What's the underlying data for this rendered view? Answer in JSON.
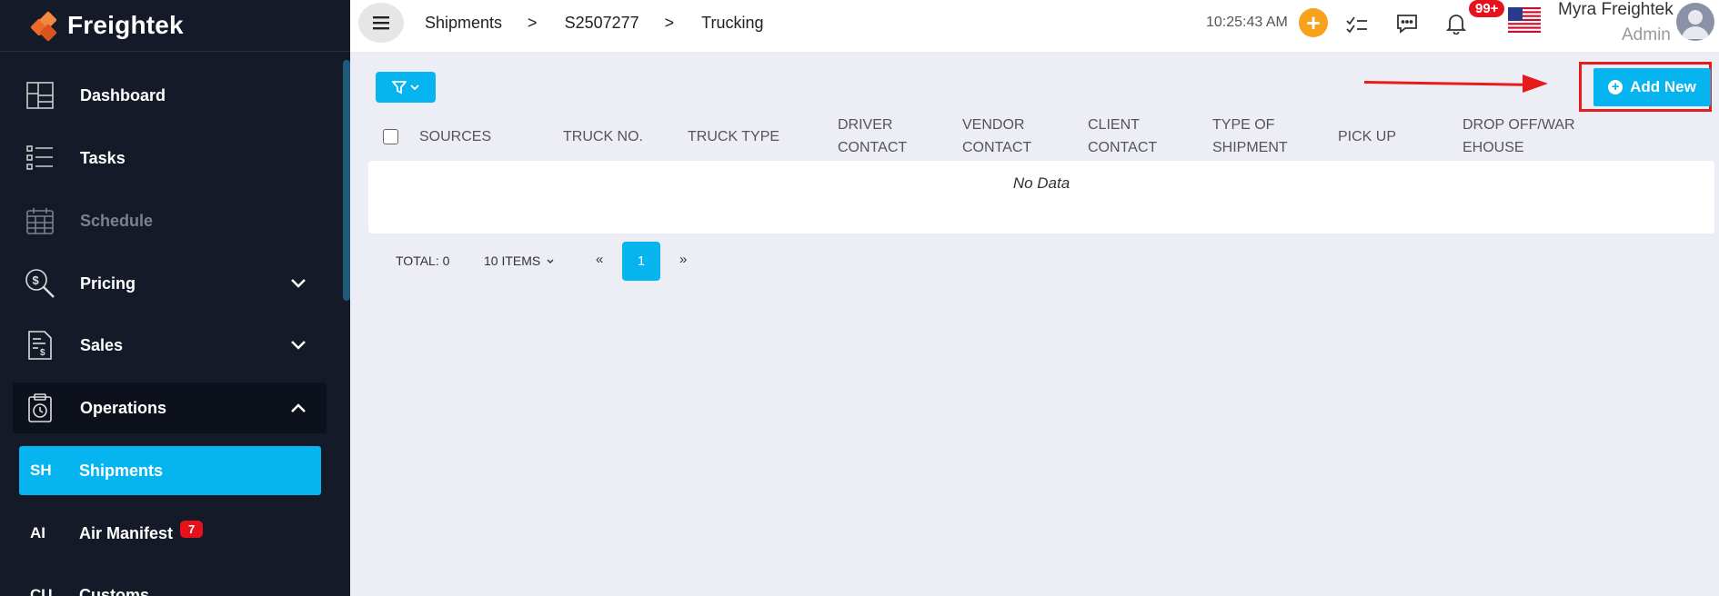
{
  "app": {
    "name": "Freightek"
  },
  "sidebar": {
    "items": [
      {
        "label": "Dashboard"
      },
      {
        "label": "Tasks"
      },
      {
        "label": "Schedule"
      },
      {
        "label": "Pricing"
      },
      {
        "label": "Sales"
      },
      {
        "label": "Operations"
      }
    ],
    "sub_items": [
      {
        "abbr": "SH",
        "label": "Shipments"
      },
      {
        "abbr": "AI",
        "label": "Air Manifest",
        "badge": "7"
      },
      {
        "abbr": "CU",
        "label": "Customs"
      }
    ]
  },
  "header": {
    "breadcrumb": [
      "Shipments",
      ">",
      "S2507277",
      ">",
      "Trucking"
    ],
    "time": "10:25:43 AM",
    "plus": "+",
    "notifications_badge": "99+",
    "user_name": "Myra Freightek",
    "user_role": "Admin"
  },
  "toolbar": {
    "add_label": "Add New"
  },
  "table": {
    "columns": [
      "SOURCES",
      "TRUCK NO.",
      "TRUCK TYPE",
      "DRIVER CONTACT",
      "VENDOR CONTACT",
      "CLIENT CONTACT",
      "TYPE OF SHIPMENT",
      "PICK UP",
      "DROP OFF/WAREHOUSE"
    ],
    "empty_text": "No Data"
  },
  "pagination": {
    "total": "TOTAL: 0",
    "items_per_page": "10 ITEMS",
    "prev": "«",
    "current": "1",
    "next": "»"
  },
  "colors": {
    "accent": "#06b4ef",
    "sidebar_bg": "#141a27",
    "highlight_red": "#e51c1c",
    "orange": "#f7a21a"
  }
}
